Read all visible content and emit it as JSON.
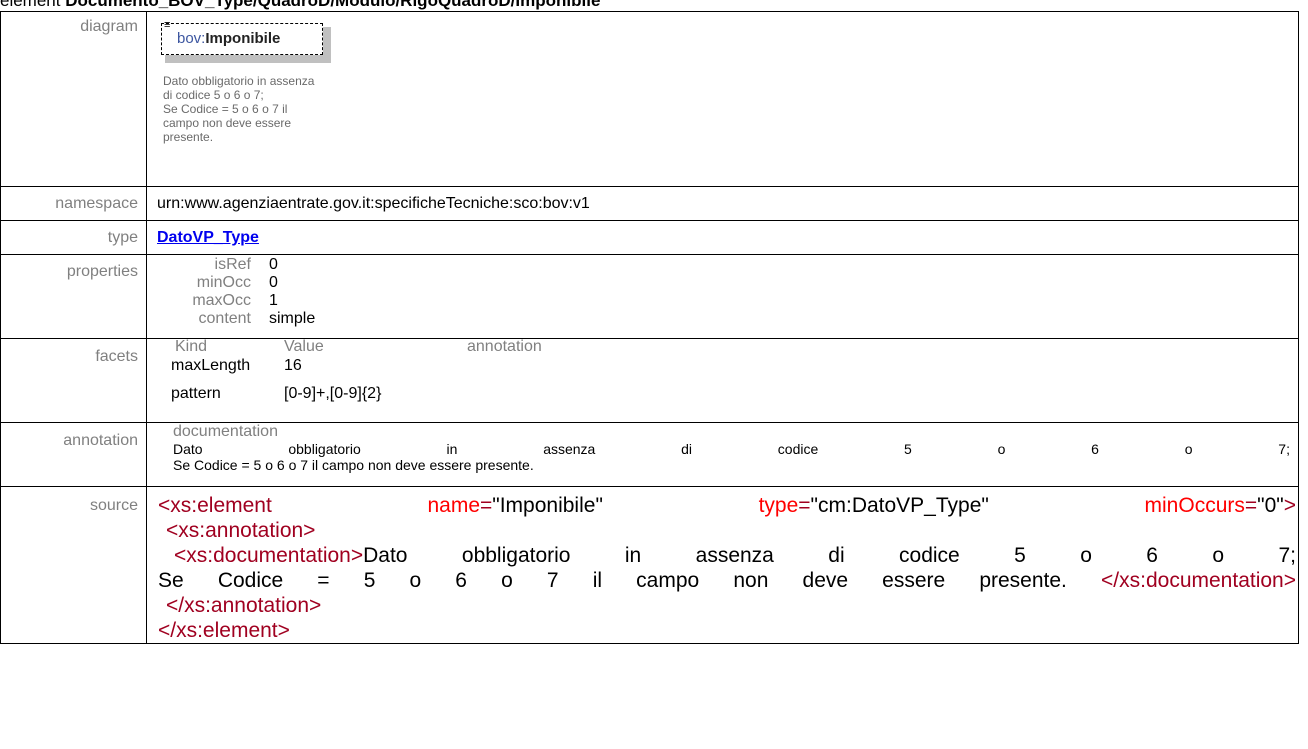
{
  "header": {
    "prefix": "element ",
    "path": "Documento_BOV_Type/QuadroD/Modulo/RigoQuadroD/Imponibile"
  },
  "labels": {
    "diagram": "diagram",
    "namespace": "namespace",
    "type": "type",
    "properties": "properties",
    "facets": "facets",
    "annotation": "annotation",
    "source": "source"
  },
  "diagram": {
    "ns_prefix": "bov:",
    "element_name": "Imponibile",
    "note_lines": [
      "Dato obbligatorio in assenza",
      "di codice 5 o 6 o 7;",
      "Se Codice = 5 o 6 o 7 il",
      "campo non deve essere",
      "presente."
    ],
    "icon": "document-lines-icon"
  },
  "namespace": "urn:www.agenziaentrate.gov.it:specificheTecniche:sco:bov:v1",
  "type": "DatoVP_Type",
  "properties": [
    {
      "key": "isRef",
      "value": "0"
    },
    {
      "key": "minOcc",
      "value": "0"
    },
    {
      "key": "maxOcc",
      "value": "1"
    },
    {
      "key": "content",
      "value": "simple"
    }
  ],
  "facets": {
    "headers": {
      "kind": "Kind",
      "value": "Value",
      "annotation": "annotation"
    },
    "rows": [
      {
        "kind": "maxLength",
        "value": "16"
      },
      {
        "kind": "pattern",
        "value": "[0-9]+,[0-9]{2}"
      }
    ]
  },
  "annotation": {
    "head": "documentation",
    "lines": [
      "Dato obbligatorio in assenza di codice 5 o 6 o 7;",
      "Se Codice = 5 o 6 o 7 il campo non deve essere presente."
    ]
  },
  "source": {
    "el_open": "<xs:element",
    "attr1_name": "name",
    "attr1_value": "\"Imponibile\"",
    "attr2_name": "type",
    "attr2_value": "\"cm:DatoVP_Type\"",
    "attr3_name": "minOccurs",
    "attr3_value": "\"0\"",
    "gt": ">",
    "eq": "=",
    "ann_open": "<xs:annotation>",
    "doc_open": "<xs:documentation>",
    "doc_text_1": "Dato obbligatorio in assenza di codice 5 o 6 o 7;",
    "doc_text_2": "Se Codice = 5 o 6 o 7 il campo non deve essere presente.",
    "doc_close": "</xs:documentation>",
    "ann_close": "</xs:annotation>",
    "el_close": "</xs:element"
  }
}
